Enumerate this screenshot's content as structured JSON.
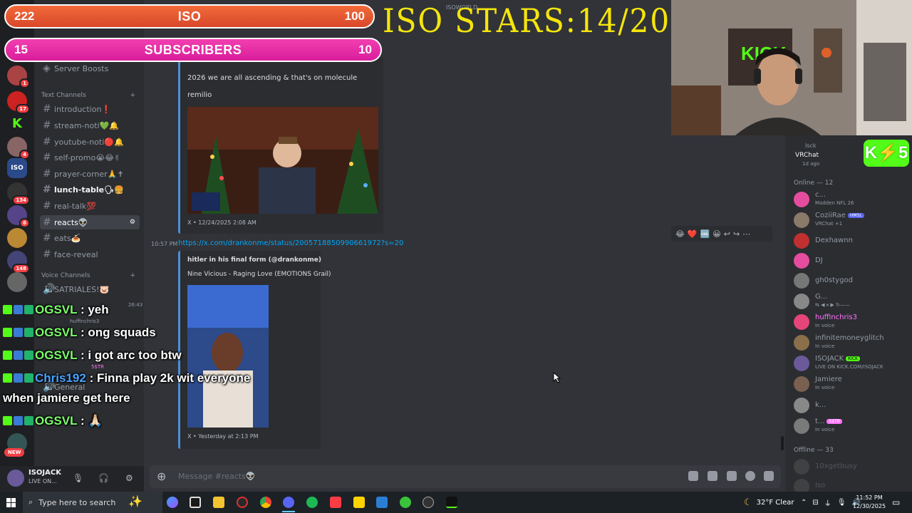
{
  "overlay": {
    "bar_iso": {
      "left": "222",
      "label": "ISO",
      "right": "100"
    },
    "bar_subs": {
      "left": "15",
      "label": "SUBSCRIBERS",
      "right": "10"
    },
    "stars": "ISO STARS:14/20",
    "small_label": "ISOWORLD"
  },
  "server_rail": {
    "badges": [
      "1",
      "17",
      "4",
      "134",
      "6",
      "148",
      "NEW"
    ]
  },
  "channels": {
    "server_boosts": "Server Boosts",
    "text_category": "Text Channels",
    "voice_category": "Voice Channels",
    "items": [
      {
        "label": "introduction❗"
      },
      {
        "label": "stream-noti💚🔔"
      },
      {
        "label": "youtube-noti🔴🔔"
      },
      {
        "label": "self-promo😭😂✌"
      },
      {
        "label": "prayer-corner🙏✝"
      },
      {
        "label": "lunch-table🗣🍔"
      },
      {
        "label": "real-talk💯"
      },
      {
        "label": "reacts👽"
      },
      {
        "label": "eats🍝"
      },
      {
        "label": "face-reveal"
      }
    ],
    "voice_items": [
      "SATRIALES!🐷",
      "General"
    ],
    "voice_users": [
      "huffinchris3",
      "5$TR"
    ],
    "voice_timer": "26:43"
  },
  "chat": {
    "embed1": {
      "text1": "2026 we are all ascending & that's on molecule",
      "text2": "remilio",
      "footer": "X • 12/24/2025 2:08 AM"
    },
    "msg2": {
      "time": "10:57 PM",
      "link": "https://x.com/drankonme/status/2005718850990661972?s=20",
      "embed_title": "hitler in his final form (@drankonme)",
      "embed_desc": "Nine Vicious - Raging Love (EMOTIONS Grail)",
      "footer": "X • Yesterday at 2:13 PM"
    },
    "input_placeholder": "Message #reacts👽",
    "reaction_bar": [
      "😂",
      "❤️",
      "🆒",
      "😀",
      "↩",
      "↪",
      "⋯"
    ]
  },
  "userbar": {
    "name": "ISOJACK",
    "status": "LIVE ON..."
  },
  "members": {
    "activity": {
      "name": "Isck",
      "title": "VRChat",
      "sub": "1d ago"
    },
    "online_label": "Online — 12",
    "offline_label": "Offline — 33",
    "list": [
      {
        "name": "c...",
        "sub": "Madden NFL 26",
        "color": "#e64c9e"
      },
      {
        "name": "CoziiRae",
        "tag": "HMSL",
        "sub": "VRChat +1",
        "color": "#8a7a6a"
      },
      {
        "name": "Dexhawnn",
        "sub": "",
        "color": "#c03030"
      },
      {
        "name": "DJ",
        "sub": "",
        "color": "#e64c9e"
      },
      {
        "name": "gh0stygod",
        "sub": "",
        "color": "#777"
      },
      {
        "name": "G...",
        "sub": "",
        "color": "#888"
      },
      {
        "name": "huffinchris3",
        "sub": "In voice",
        "color": "#e6457a"
      },
      {
        "name": "infinitemoneyglitch",
        "sub": "In voice",
        "color": "#8a6f4a"
      },
      {
        "name": "ISOJACK",
        "tag": "KICK",
        "sub": "LIVE ON KICK.COM/ISOJACK",
        "color": "#6a5a9a"
      },
      {
        "name": "Jamiere",
        "sub": "In voice",
        "color": "#7a6050"
      },
      {
        "name": "k...",
        "sub": "",
        "color": "#888"
      },
      {
        "name": "t...",
        "tag": "5$TR",
        "sub": "In voice",
        "color": "#7a7a7a"
      }
    ],
    "offline": [
      "10xgetbusy",
      "Iso"
    ]
  },
  "stream_chat": [
    {
      "user": "OGSVL",
      "msg": ": yeh",
      "color": "green"
    },
    {
      "user": "OGSVL",
      "msg": ": ong squads",
      "color": "green"
    },
    {
      "user": "OGSVL",
      "msg": ": i got arc too btw",
      "color": "green"
    },
    {
      "user": "Chris192",
      "msg": ": Finna play 2k wit everyone",
      "color": "blue"
    },
    {
      "user": "",
      "msg": "when jamiere get here",
      "color": "none"
    },
    {
      "user": "OGSVL",
      "msg": ": 🙏🏻",
      "color": "green"
    }
  ],
  "taskbar": {
    "search_placeholder": "Type here to search",
    "weather": "32°F  Clear",
    "time": "11:52 PM",
    "date": "12/30/2025"
  }
}
